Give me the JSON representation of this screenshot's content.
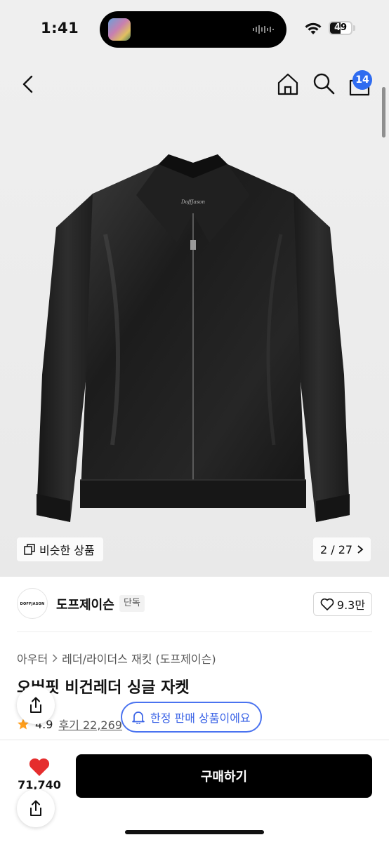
{
  "status_bar": {
    "time": "1:41",
    "battery": "49",
    "battery_level": 0.49
  },
  "header": {
    "cart_count": "14"
  },
  "hero": {
    "similar_label": "비슷한 상품",
    "page_indicator": "2 / 27",
    "jacket_label": "DoffJason"
  },
  "brand": {
    "logo_text": "DOFFJASON",
    "name": "도프제이슨",
    "tag": "단독",
    "likes": "9.3만"
  },
  "product": {
    "breadcrumb": [
      "아우터",
      "레더/라이더스 재킷 (도프제이슨)"
    ],
    "title": "오버핏 비건레더 싱글 자켓",
    "rating": "4.9",
    "review": "후기 22,269"
  },
  "toast": {
    "label": "한정 판매 상품이에요"
  },
  "bottom_bar": {
    "heart_count": "71,740",
    "buy_label": "구매하기"
  },
  "colors": {
    "accent_blue": "#2f6cf0",
    "heart_red": "#e52d2d",
    "star_orange": "#ff9e1b"
  }
}
